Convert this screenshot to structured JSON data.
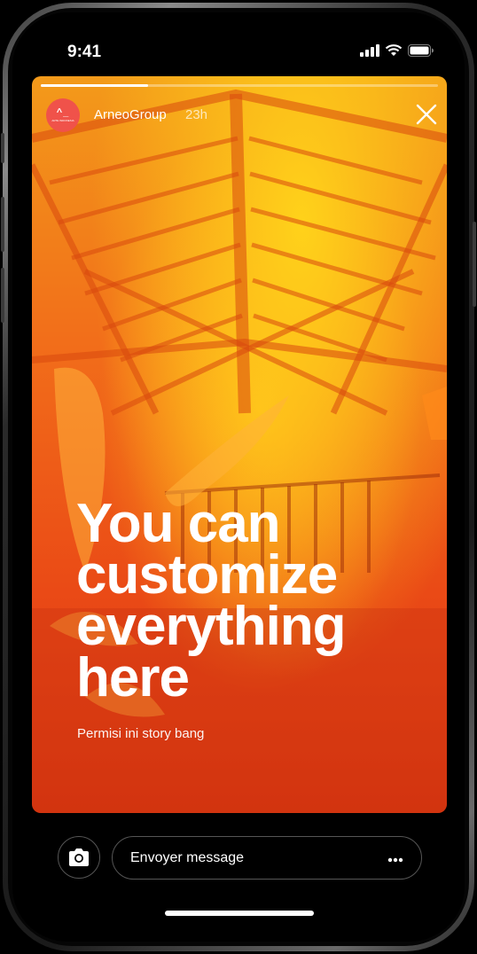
{
  "status_bar": {
    "time": "9:41",
    "icons": [
      "signal-icon",
      "wifi-icon",
      "battery-icon"
    ]
  },
  "story": {
    "progress": 0.27,
    "author": {
      "avatar_mark": "^_",
      "avatar_subtitle": "ARTE INDONESIA",
      "name": "ArneoGroup",
      "time_ago": "23h"
    },
    "headline": "You can customize everything here",
    "caption": "Permisi ini story bang",
    "close_icon": "close-icon"
  },
  "reply_bar": {
    "camera_icon": "camera-icon",
    "placeholder": "Envoyer message",
    "more_icon": "more-dots-icon"
  },
  "colors": {
    "avatar_bg": "#f0524a",
    "story_top": "#ffd21a",
    "story_bottom": "#d8360f"
  }
}
